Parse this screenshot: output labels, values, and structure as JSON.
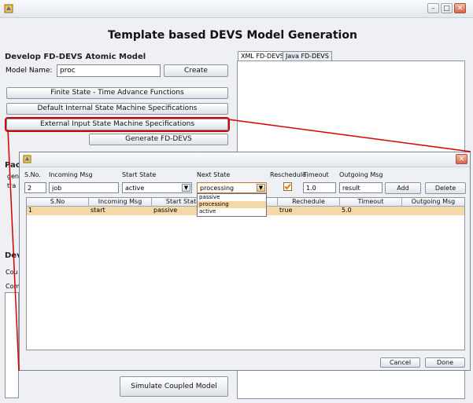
{
  "window": {
    "title": "",
    "controls": {
      "minimize": "–",
      "maximize": "□",
      "close": "✕"
    }
  },
  "app_title": "Template based DEVS Model Generation",
  "atomic": {
    "section_title": "Develop FD-DEVS Atomic Model",
    "model_name_label": "Model Name:",
    "model_name_value": "proc",
    "create_label": "Create",
    "finite_state_label": "Finite State - Time Advance Functions",
    "default_internal_label": "Default Internal State Machine Specifications",
    "external_input_label": "External Input State Machine Specifications",
    "generate_label": "Generate FD-DEVS"
  },
  "hidden_partial": {
    "pac": "Pac",
    "gen": "gen",
    "tra": "tra",
    "dev": "Dev",
    "cou": "Cou",
    "com": "Com"
  },
  "tabs": [
    {
      "label": "XML FD-DEVS",
      "active": true
    },
    {
      "label": "Java FD-DEVS",
      "active": false
    }
  ],
  "simulate_label": "Simulate Coupled Model",
  "dialog": {
    "close_glyph": "✕",
    "labels": {
      "sno": "S.No.",
      "incoming": "Incoming Msg",
      "start_state": "Start State",
      "next_state": "Next State",
      "reschedule": "Reschedule",
      "timeout": "Timeout",
      "outgoing": "Outgoing Msg"
    },
    "inputs": {
      "sno": "2",
      "incoming": "job",
      "start_state": "active",
      "next_state": "processing",
      "reschedule_checked": true,
      "timeout": "1.0",
      "outgoing": "result"
    },
    "add_label": "Add",
    "delete_label": "Delete",
    "dropdown_options": [
      "passive",
      "processing",
      "active"
    ],
    "dropdown_selected": "processing",
    "table": {
      "columns": [
        "S.No",
        "Incoming Msg",
        "Start State",
        "Rechedule",
        "Timeout",
        "Outgoing Msg"
      ],
      "rows": [
        {
          "sno": "1",
          "incoming": "start",
          "start_state": "passive",
          "reschedule": "true",
          "timeout": "5.0",
          "outgoing": ""
        }
      ]
    },
    "cancel_label": "Cancel",
    "done_label": "Done"
  },
  "colors": {
    "accent_red": "#d40000",
    "row_highlight": "#f6d7a8",
    "checkbox_orange": "#e07a10"
  }
}
